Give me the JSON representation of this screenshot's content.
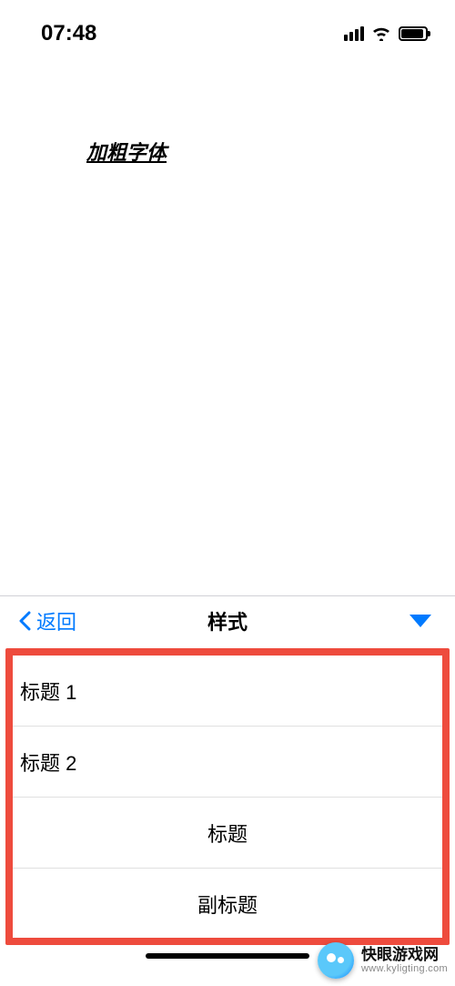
{
  "statusBar": {
    "time": "07:48"
  },
  "content": {
    "boldText": "加粗字体"
  },
  "panel": {
    "back": "返回",
    "title": "样式"
  },
  "styles": {
    "heading1": "标题 1",
    "heading2": "标题 2",
    "title": "标题",
    "subtitle": "副标题"
  },
  "watermark": {
    "title": "快眼游戏网",
    "url": "www.kyligting.com"
  }
}
